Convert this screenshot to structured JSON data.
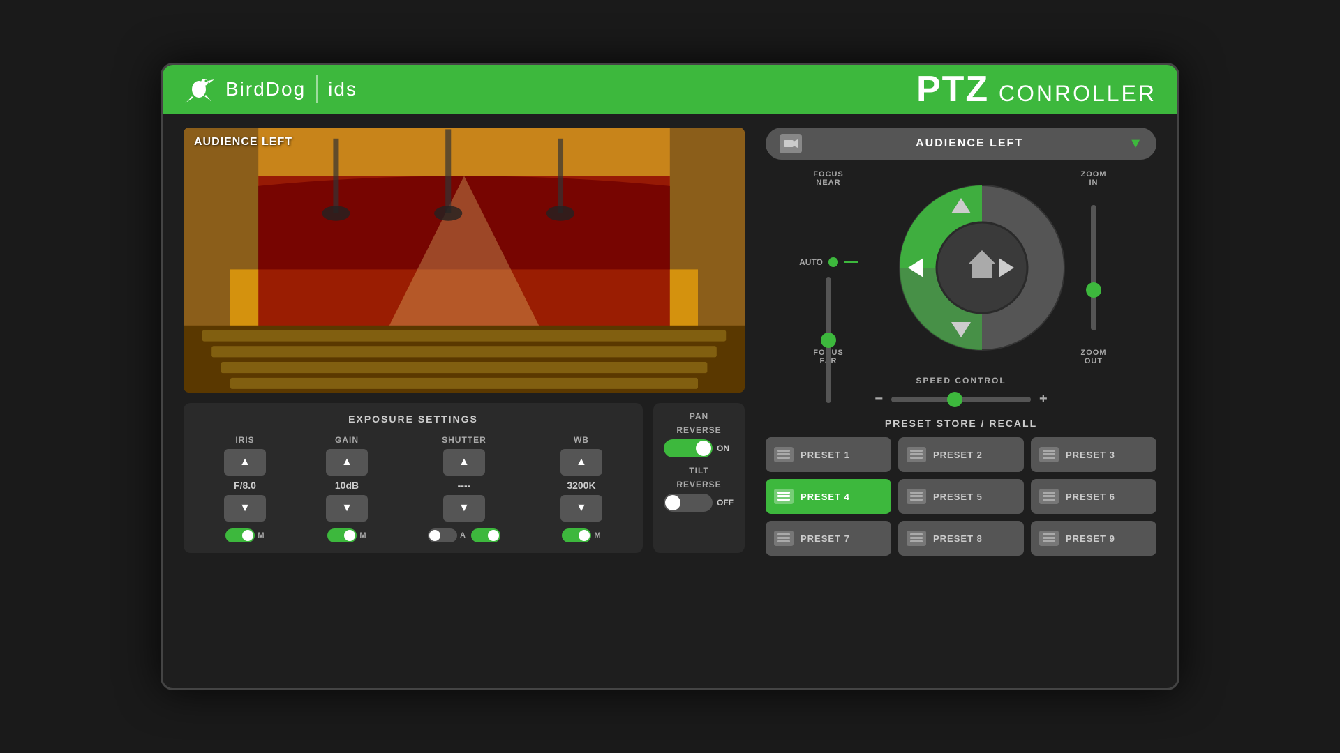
{
  "header": {
    "brand": "BirdDog",
    "partner": "ids",
    "title_ptz": "PTZ",
    "title_controller": "CONROLLER"
  },
  "camera": {
    "selected": "AUDIENCE LEFT"
  },
  "preview": {
    "label": "AUDIENCE LEFT"
  },
  "ptz": {
    "focus_near": "FOCUS\nNEAR",
    "focus_near_label": "FOCUS",
    "focus_near_sub": "NEAR",
    "focus_far_label": "FOCUS",
    "focus_far_sub": "FAR",
    "auto_label": "AUTO",
    "zoom_in_label": "ZOOM",
    "zoom_in_sub": "IN",
    "zoom_out_label": "ZOOM",
    "zoom_out_sub": "OUT",
    "speed_label": "SPEED CONTROL"
  },
  "exposure": {
    "title": "EXPOSURE SETTINGS",
    "iris_label": "IRIS",
    "iris_value": "F/8.0",
    "iris_mode": "M",
    "gain_label": "GAIN",
    "gain_value": "10dB",
    "gain_mode": "M",
    "shutter_label": "SHUTTER",
    "shutter_value": "----",
    "shutter_mode": "A",
    "wb_label": "WB",
    "wb_value": "3200K",
    "wb_mode": "M"
  },
  "pan_reverse": {
    "label_line1": "PAN",
    "label_line2": "REVERSE",
    "state": "ON",
    "enabled": true
  },
  "tilt_reverse": {
    "label_line1": "TILT",
    "label_line2": "REVERSE",
    "state": "OFF",
    "enabled": false
  },
  "presets": {
    "title": "PRESET STORE / RECALL",
    "items": [
      {
        "id": 1,
        "label": "PRESET 1",
        "active": false
      },
      {
        "id": 2,
        "label": "PRESET 2",
        "active": false
      },
      {
        "id": 3,
        "label": "PRESET 3",
        "active": false
      },
      {
        "id": 4,
        "label": "PRESET 4",
        "active": true
      },
      {
        "id": 5,
        "label": "PRESET 5",
        "active": false
      },
      {
        "id": 6,
        "label": "PRESET 6",
        "active": false
      },
      {
        "id": 7,
        "label": "PRESET 7",
        "active": false
      },
      {
        "id": 8,
        "label": "PRESET 8",
        "active": false
      },
      {
        "id": 9,
        "label": "PRESET 9",
        "active": false
      }
    ]
  }
}
